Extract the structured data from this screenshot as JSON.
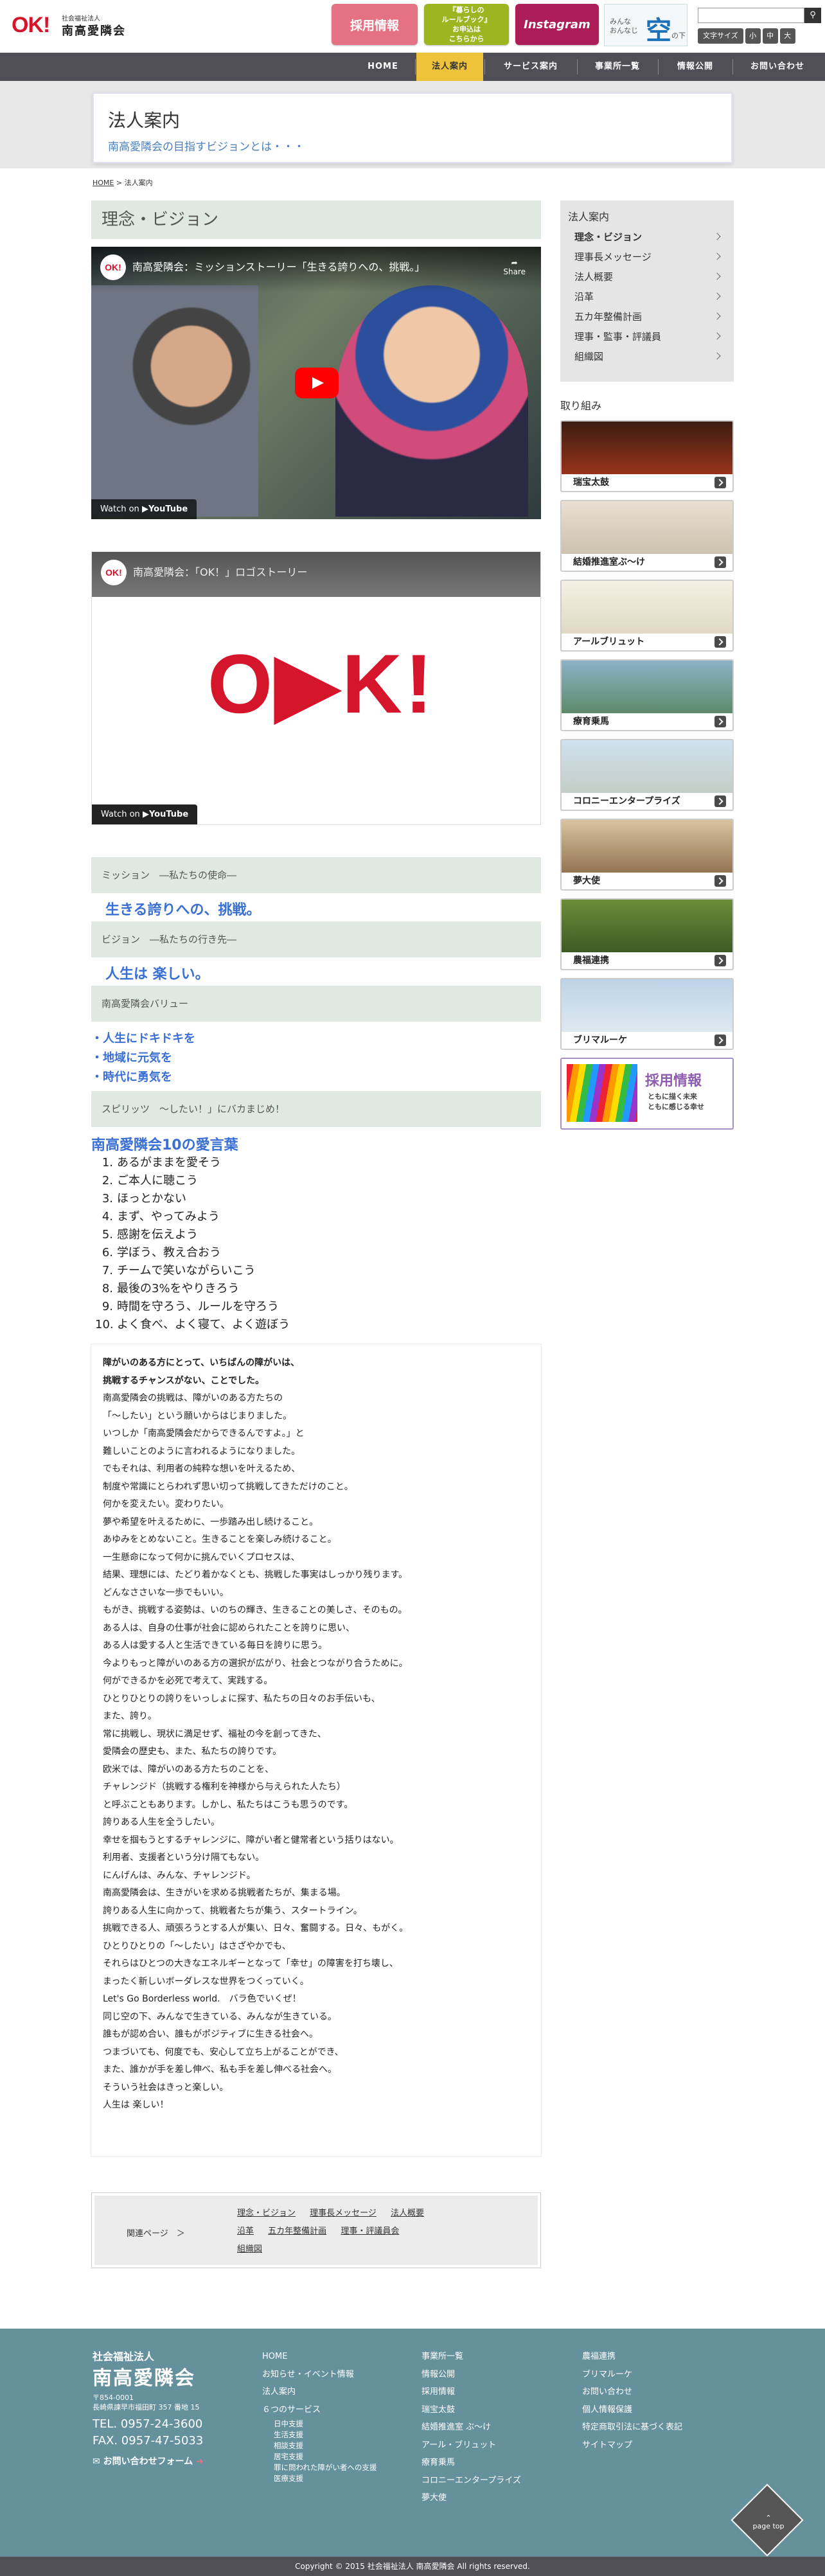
{
  "header": {
    "logo_mark": "OK!",
    "org_type": "社会福祉法人",
    "org_name": "南高愛隣会",
    "recruit_label": "採用情報",
    "book_label_1": "『暮らしの",
    "book_label_2": "ルールブック』",
    "book_label_3": "お申込は",
    "book_label_4": "こちらから",
    "insta_label": "Instagram",
    "sky_text_1": "みんな",
    "sky_text_2": "おんなじ",
    "sky_kanji": "空",
    "sky_text_3": "の下",
    "search_placeholder": "",
    "font_size_label": "文字サイズ",
    "font_sizes": [
      "小",
      "中",
      "大"
    ]
  },
  "nav": {
    "items": [
      "HOME",
      "法人案内",
      "サービス案内",
      "事業所一覧",
      "情報公開",
      "お問い合わせ"
    ],
    "active": "法人案内"
  },
  "page_head": {
    "title": "法人案内",
    "subtitle": "南高愛隣会の目指すビジョンとは・・・"
  },
  "breadcrumb": {
    "home": "HOME",
    "sep": ">",
    "current": "法人案内"
  },
  "main": {
    "section_title": "理念・ビジョン",
    "video1": {
      "title": "南高愛隣会：ミッションストーリー「生きる誇りへの、挑戦。」",
      "share": "Share",
      "watch": "Watch on",
      "yt": "YouTube"
    },
    "video2": {
      "title": "南高愛隣会：「OK！」ロゴストーリー",
      "watch": "Watch on",
      "yt": "YouTube"
    },
    "mission_head": "ミッション　―私たちの使命―",
    "mission_text": "生きる誇りへの、挑戦。",
    "vision_head": "ビジョン　―私たちの行き先―",
    "vision_text": "人生は 楽しい。",
    "value_head": "南高愛隣会バリュー",
    "values": [
      "・人生にドキドキを",
      "・地域に元気を",
      "・時代に勇気を"
    ],
    "spirit_head": "スピリッツ　～したい！」にバカまじめ！",
    "ten_title": "南高愛隣会10の愛言葉",
    "ten_words": [
      "あるがままを愛そう",
      "ご本人に聴こう",
      "ほっとかない",
      "まず、やってみよう",
      "感謝を伝えよう",
      "学ぼう、教え合おう",
      "チームで笑いながらいこう",
      "最後の3%をやりきろう",
      "時間を守ろう、ルールを守ろう",
      "よく食べ、よく寝て、よく遊ぼう"
    ],
    "essay": [
      "障がいのある方にとって、いちばんの障がいは、",
      "挑戦するチャンスがない、ことでした。",
      "南高愛隣会の挑戦は、障がいのある方たちの",
      "「〜したい」という願いからはじまりました。",
      "いつしか「南高愛隣会だからできるんですよ。」と",
      "難しいことのように言われるようになりました。",
      "でもそれは、利用者の純粋な想いを叶えるため、",
      "制度や常識にとらわれず思い切って挑戦してきただけのこと。",
      "何かを変えたい。変わりたい。",
      "夢や希望を叶えるために、一歩踏み出し続けること。",
      "あゆみをとめないこと。生きることを楽しみ続けること。",
      "一生懸命になって何かに挑んでいくプロセスは、",
      "結果、理想には、たどり着かなくとも、挑戦した事実はしっかり残ります。",
      "どんなささいな一歩でもいい。",
      "もがき、挑戦する姿勢は、いのちの輝き、生きることの美しさ、そのもの。",
      "ある人は、自身の仕事が社会に認められたことを誇りに思い、",
      "ある人は愛する人と生活できている毎日を誇りに思う。",
      "今よりもっと障がいのある方の選択が広がり、社会とつながり合うために。",
      "何ができるかを必死で考えて、実践する。",
      "ひとりひとりの誇りをいっしょに探す、私たちの日々のお手伝いも、",
      "また、誇り。",
      "常に挑戦し、現状に満足せず、福祉の今を創ってきた、",
      "愛隣会の歴史も、また、私たちの誇りです。",
      "欧米では、障がいのある方たちのことを、",
      "チャレンジド（挑戦する権利を神様から与えられた人たち）",
      "と呼ぶこともあります。しかし、私たちはこうも思うのです。",
      "誇りある人生を全うしたい。",
      "幸せを掴もうとするチャレンジに、障がい者と健常者という括りはない。",
      "利用者、支援者という分け隔てもない。",
      "にんげんは、みんな、チャレンジド。",
      "南高愛隣会は、生きがいを求める挑戦者たちが、集まる場。",
      "誇りある人生に向かって、挑戦者たちが集う、スタートライン。",
      "挑戦できる人、頑張ろうとする人が集い、日々、奮闘する。日々、もがく。",
      "ひとりひとりの「〜したい」はさざやかでも、",
      "それらはひとつの大きなエネルギーとなって「幸せ」の障害を打ち壊し、",
      "まったく新しいボーダレスな世界をつくっていく。",
      "Let's Go Borderless world.　バラ色でいくぜ！",
      "同じ空の下、みんなで生きている、みんなが生きている。",
      "誰もが認め合い、誰もがポジティブに生きる社会へ。",
      "つまづいても、何度でも、安心して立ち上がることができ、",
      "また、誰かが手を差し伸べ、私も手を差し伸べる社会へ。",
      "そういう社会はきっと楽しい。",
      "人生は 楽しい！"
    ],
    "related_label": "関連ページ　＞",
    "related_links": [
      "理念・ビジョン",
      "理事長メッセージ",
      "法人概要",
      "沿革",
      "五カ年整備計画",
      "理事・評議員会",
      "組織図"
    ]
  },
  "sidebar": {
    "title": "法人案内",
    "items": [
      "理念・ビジョン",
      "理事長メッセージ",
      "法人概要",
      "沿革",
      "五カ年整備計画",
      "理事・監事・評議員",
      "組織図"
    ],
    "current": "理念・ビジョン",
    "torikumi_title": "取り組み",
    "banners": [
      "瑞宝太鼓",
      "結婚推進室ぶ〜け",
      "アールブリュット",
      "療育乗馬",
      "コロニーエンタープライズ",
      "夢大使",
      "農福連携",
      "ブリマルーケ",
      "採用情報"
    ],
    "recruit_sub_1": "ともに描く未来",
    "recruit_sub_2": "ともに感じる幸せ"
  },
  "footer": {
    "org_type": "社会福祉法人",
    "org_name": "南高愛隣会",
    "zip": "〒854-0001",
    "address": "長崎県諫早市福田町 357 番地 15",
    "tel": "TEL. 0957-24-3600",
    "fax": "FAX. 0957-47-5033",
    "contact": "お問い合わせフォーム",
    "col1": [
      "HOME",
      "お知らせ・イベント情報",
      "法人案内",
      "６つのサービス"
    ],
    "col1_sub": [
      "日中支援",
      "生活支援",
      "相談支援",
      "居宅支援",
      "罪に問われた障がい者への支援",
      "医療支援"
    ],
    "col2": [
      "事業所一覧",
      "情報公開",
      "採用情報",
      "瑞宝太鼓",
      "結婚推進室 ぶ〜け",
      "アール・ブリュット",
      "療育乗馬",
      "コロニーエンタープライズ",
      "夢大使"
    ],
    "col3": [
      "農福連携",
      "ブリマルーケ",
      "お問い合わせ",
      "個人情報保護",
      "特定商取引法に基づく表記",
      "サイトマップ"
    ],
    "page_top": "page top",
    "copyright": "Copyright © 2015 社会福祉法人 南高愛隣会 All rights reserved."
  },
  "colors": {
    "accent_blue": "#3a6fd4",
    "nav_active": "#eec23b",
    "footer": "#64919c",
    "brand_red": "#d5152b"
  }
}
